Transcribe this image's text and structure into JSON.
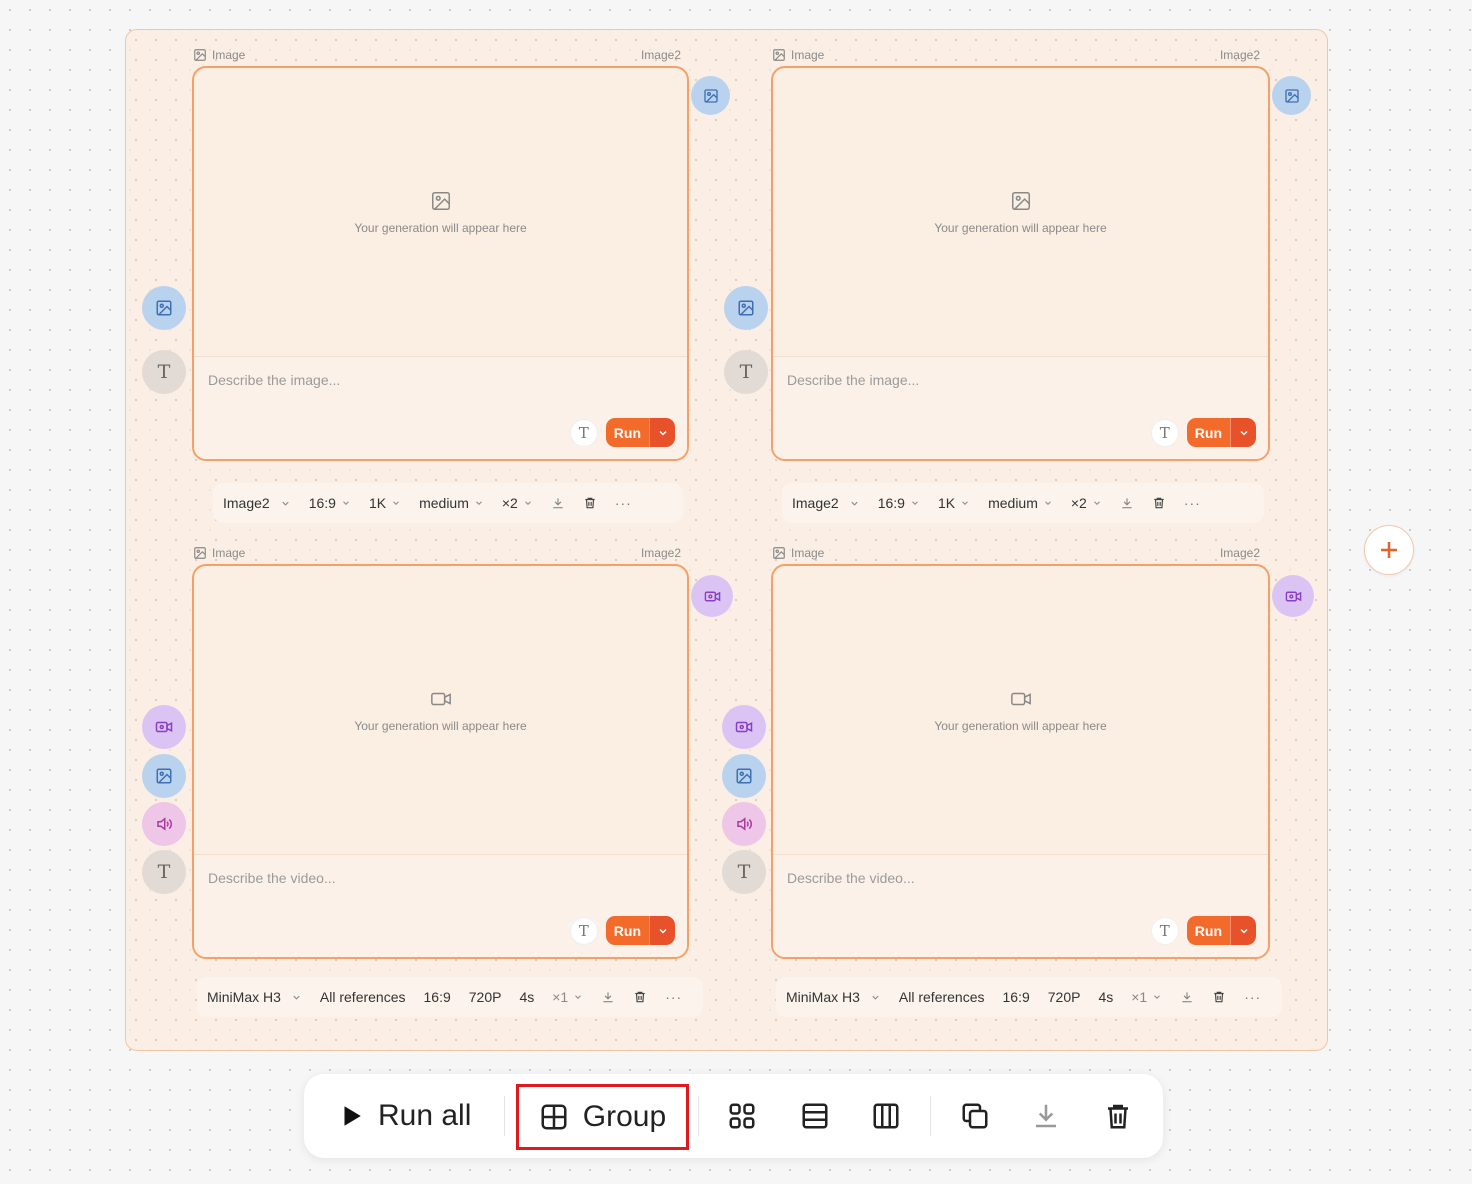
{
  "colors": {
    "accent": "#f26b2a",
    "frame_border": "#f2c6a4",
    "card_border": "#f4a068",
    "group_highlight": "#e0191e"
  },
  "nodes": [
    {
      "label": "Image",
      "model_label": "Image2",
      "media": "image",
      "preview_text": "Your generation will appear here",
      "prompt_placeholder": "Describe the image...",
      "run_label": "Run",
      "params": {
        "model": "Image2",
        "ratio": "16:9",
        "resolution": "1K",
        "quality": "medium",
        "count": "×2"
      }
    },
    {
      "label": "Image",
      "model_label": "Image2",
      "media": "image",
      "preview_text": "Your generation will appear here",
      "prompt_placeholder": "Describe the image...",
      "run_label": "Run",
      "params": {
        "model": "Image2",
        "ratio": "16:9",
        "resolution": "1K",
        "quality": "medium",
        "count": "×2"
      }
    },
    {
      "label": "Image",
      "model_label": "Image2",
      "media": "video",
      "preview_text": "Your generation will appear here",
      "prompt_placeholder": "Describe the video...",
      "run_label": "Run",
      "params": {
        "model": "MiniMax H3",
        "references": "All references",
        "ratio": "16:9",
        "resolution": "720P",
        "duration": "4s",
        "count": "×1"
      }
    },
    {
      "label": "Image",
      "model_label": "Image2",
      "media": "video",
      "preview_text": "Your generation will appear here",
      "prompt_placeholder": "Describe the video...",
      "run_label": "Run",
      "params": {
        "model": "MiniMax H3",
        "references": "All references",
        "ratio": "16:9",
        "resolution": "720P",
        "duration": "4s",
        "count": "×1"
      }
    }
  ],
  "side_inputs": {
    "text_glyph": "T"
  },
  "toolbar": {
    "run_all_label": "Run all",
    "group_label": "Group",
    "icons": [
      "play-icon",
      "group-icon",
      "grid-layout-icon",
      "rows-layout-icon",
      "columns-layout-icon",
      "duplicate-icon",
      "download-icon",
      "trash-icon"
    ]
  }
}
